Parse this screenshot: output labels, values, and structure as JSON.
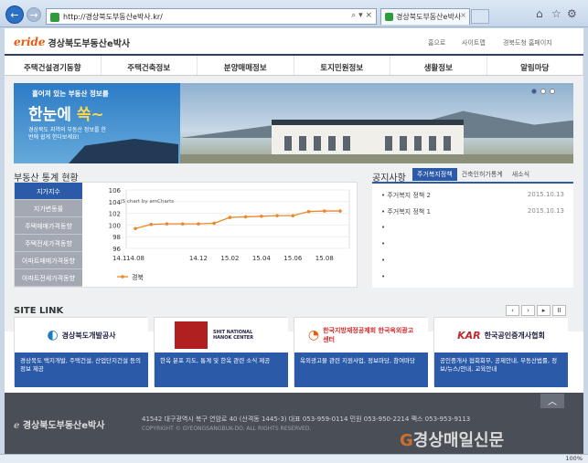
{
  "browser": {
    "address": "http://경상북도부동산e박사.kr/",
    "tab_title": "경상북도부동산e박사",
    "zoom": "100%"
  },
  "site": {
    "logo_brand": "eride",
    "logo_brand_sub": "GyeongBuk",
    "title": "경상북도부동산e박사",
    "top_links": [
      "홈으로",
      "사이트맵",
      "경북도청 홈페이지"
    ]
  },
  "gnb": [
    "주택건설경기동향",
    "주택건축정보",
    "분양매매정보",
    "토지민원정보",
    "생활정보",
    "알림마당"
  ],
  "banner": {
    "line1": "흩어져 있는 부동산 정보를",
    "line2a": "한눈에 ",
    "line2b": "쏙~",
    "line3": "경상북도 지역의 부동산 정보를 한번에 쉽게 한다보세요!"
  },
  "stats": {
    "title": "부동산 통계 현황",
    "nav": [
      "지가지수",
      "지가변동률",
      "주택매매가격동향",
      "주택전세가격동향",
      "아파트매매가격동향",
      "아파트전세가격동향"
    ],
    "chart_credit": "JS chart by amCharts"
  },
  "chart_data": {
    "type": "line",
    "title": "",
    "xlabel": "",
    "ylabel": "",
    "categories": [
      "14.08",
      "14.1",
      "14.12",
      "15.02",
      "15.04",
      "15.06",
      "15.08"
    ],
    "x": [
      "14.08",
      "14.09",
      "14.10",
      "14.11",
      "14.12",
      "15.01",
      "15.02",
      "15.03",
      "15.04",
      "15.05",
      "15.06",
      "15.07",
      "15.08",
      "15.09"
    ],
    "series": [
      {
        "name": "경북",
        "values": [
          99.4,
          100.1,
          100.2,
          100.2,
          100.2,
          100.3,
          101.3,
          101.4,
          101.5,
          101.6,
          101.6,
          102.3,
          102.4,
          102.4
        ]
      }
    ],
    "ylim": [
      96,
      106
    ],
    "yticks": [
      96,
      98,
      100,
      102,
      104,
      106
    ],
    "grid": true,
    "legend": "bottom-left",
    "color": "#e8892b"
  },
  "notice": {
    "title": "공지사항",
    "tabs": [
      "주거복지정책",
      "건축인허가통계",
      "새소식"
    ],
    "items": [
      {
        "title": "주거복지 정책 2",
        "date": "2015.10.13"
      },
      {
        "title": "주거복지 정책 1",
        "date": "2015.10.13"
      },
      {
        "title": "",
        "date": ""
      },
      {
        "title": "",
        "date": ""
      },
      {
        "title": "",
        "date": ""
      },
      {
        "title": "",
        "date": ""
      }
    ]
  },
  "sitelink": {
    "title": "SITE LINK",
    "controls": [
      "‹",
      "›",
      "▸",
      "II"
    ],
    "cards": [
      {
        "name": "경상북도개발공사",
        "desc": "경상북도 택지개발, 주택건설, 산업단지건설 등의 정보 제공"
      },
      {
        "name": "SHIT NATIONAL HANOK CENTER",
        "desc": "한옥 분포 지도, 통계 및 한옥 관련 소식 제공"
      },
      {
        "name": "한국지방재정공제회 한국옥외광고센터",
        "desc": "옥외광고물 관련 지원사업, 정보마당, 참여마당"
      },
      {
        "name": "한국공인중개사협회",
        "desc": "공인중개사 협회회무, 공제안내, 부동산법률, 정보/뉴스/안내, 교육안내"
      }
    ]
  },
  "footer": {
    "logo": "경상북도부동산e박사",
    "address": "41542 대구광역시 북구 연암로 40 (산격동 1445-3)     대표 053-959-0114     민원 053-950-2214     팩스 053-953-9113",
    "copyright": "COPYRIGHT © GYEONGSANGBUK-DO. ALL RIGHTS RESERVED.",
    "watermark_g": "G",
    "watermark": "경상매일신문"
  }
}
